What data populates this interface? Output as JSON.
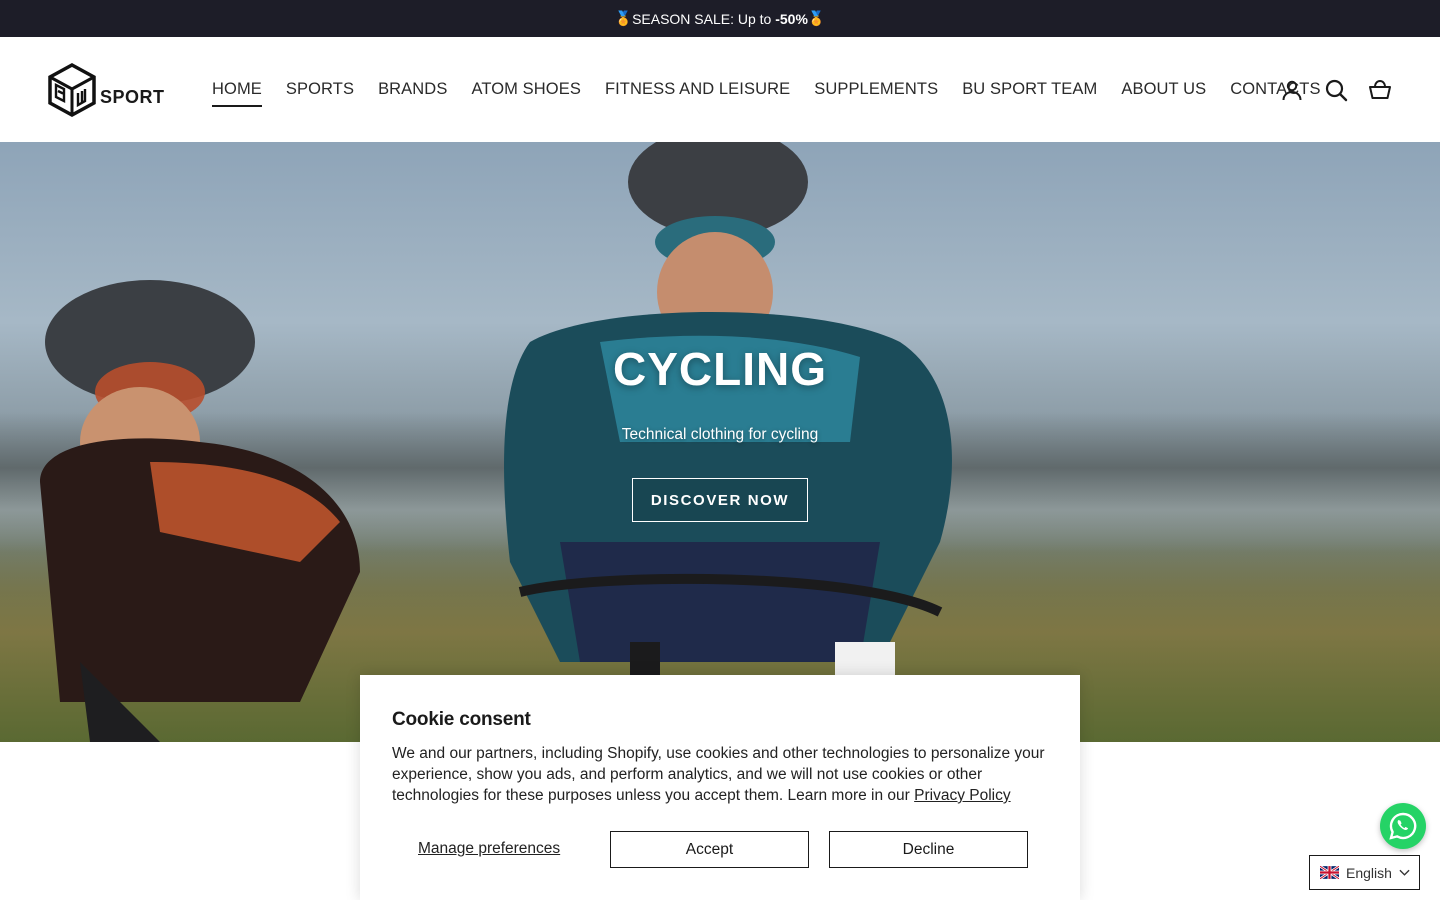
{
  "announcement": {
    "prefix": "SEASON SALE: Up to ",
    "highlight": "-50%",
    "medal": "🏅"
  },
  "brand": {
    "logo_letters": "BU",
    "name": "SPORT"
  },
  "nav": [
    {
      "label": "HOME",
      "active": true
    },
    {
      "label": "SPORTS"
    },
    {
      "label": "BRANDS"
    },
    {
      "label": "ATOM SHOES"
    },
    {
      "label": "FITNESS AND LEISURE"
    },
    {
      "label": "SUPPLEMENTS"
    },
    {
      "label": "BU SPORT TEAM"
    },
    {
      "label": "ABOUT US"
    },
    {
      "label": "CONTACTS"
    }
  ],
  "header_icons": [
    "account-icon",
    "search-icon",
    "cart-icon"
  ],
  "hero": {
    "title": "CYCLING",
    "subtitle": "Technical clothing for cycling",
    "cta": "DISCOVER NOW"
  },
  "cookie": {
    "title": "Cookie consent",
    "body": "We and our partners, including Shopify, use cookies and other technologies to personalize your experience, show you ads, and perform analytics, and we will not use cookies or other technologies for these purposes unless you accept them. Learn more in our ",
    "policy_link": "Privacy Policy",
    "manage": "Manage preferences",
    "accept": "Accept",
    "decline": "Decline"
  },
  "language": {
    "selected": "English"
  },
  "colors": {
    "announcement_bg": "#1d1d28",
    "whatsapp": "#25d366"
  }
}
